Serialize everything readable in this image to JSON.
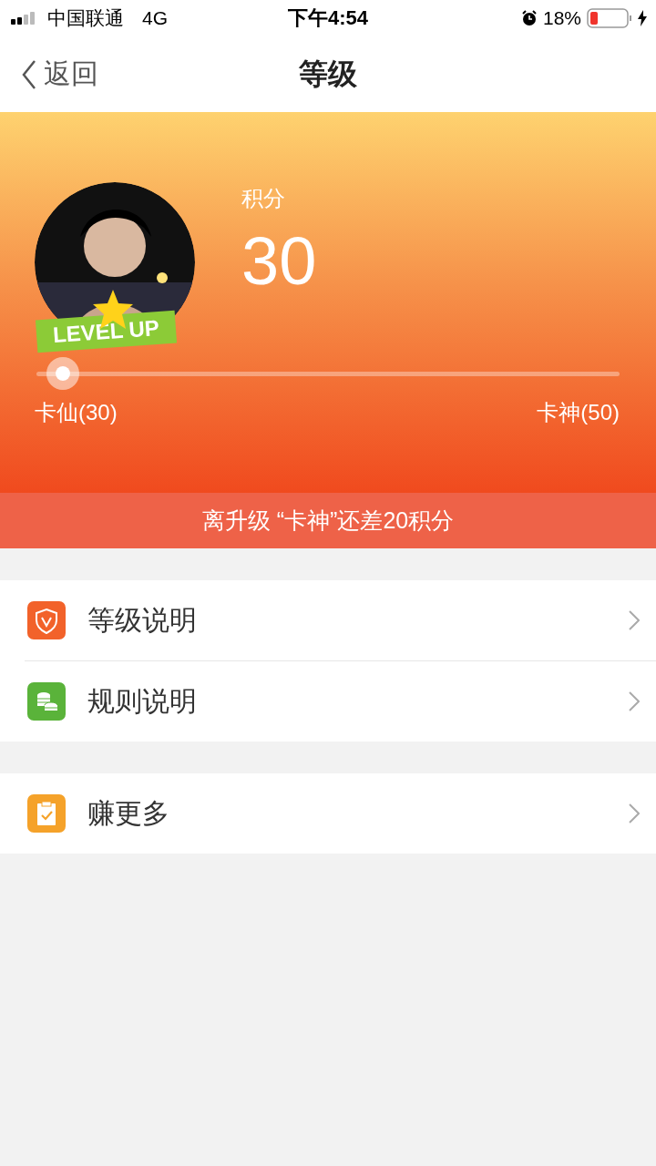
{
  "status_bar": {
    "carrier": "中国联通",
    "network": "4G",
    "time": "下午4:54",
    "battery": "18%"
  },
  "nav": {
    "back": "返回",
    "title": "等级"
  },
  "header": {
    "badge": "LEVEL UP",
    "score_label": "积分",
    "score": "30",
    "progress": {
      "level": 0.02,
      "from": "卡仙(30)",
      "to": "卡神(50)"
    }
  },
  "notice": "离升级 “卡神”还差20积分",
  "menu_groups": [
    [
      {
        "label": "等级说明",
        "kind": "shield"
      },
      {
        "label": "规则说明",
        "kind": "coins"
      }
    ],
    [
      {
        "label": "赚更多",
        "kind": "clipboard"
      }
    ]
  ]
}
